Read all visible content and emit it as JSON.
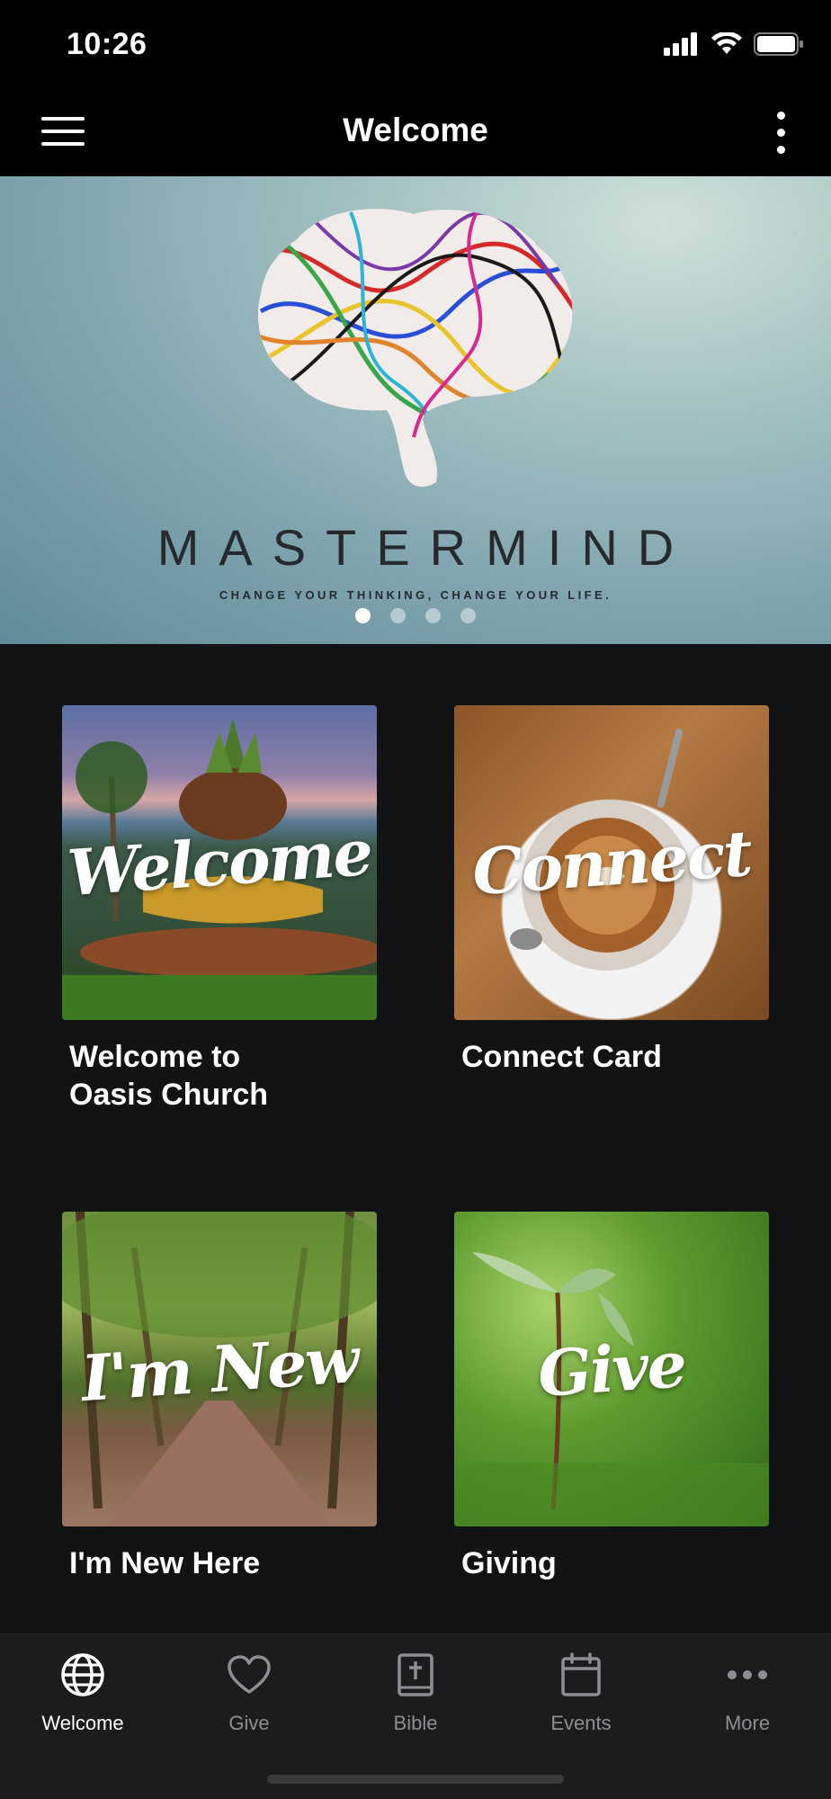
{
  "status_bar": {
    "time": "10:26"
  },
  "nav": {
    "title": "Welcome"
  },
  "hero": {
    "title": "MASTERMIND",
    "tagline": "CHANGE YOUR THINKING, CHANGE YOUR LIFE.",
    "slide_count": 4,
    "active_slide": 1
  },
  "cards": [
    {
      "script": "Welcome",
      "label": "Welcome to\nOasis Church"
    },
    {
      "script": "Connect",
      "label": "Connect Card"
    },
    {
      "script": "I'm New",
      "label": "I'm New Here"
    },
    {
      "script": "Give",
      "label": "Giving"
    }
  ],
  "tabs": [
    {
      "label": "Welcome",
      "icon": "globe-icon",
      "active": true
    },
    {
      "label": "Give",
      "icon": "heart-icon",
      "active": false
    },
    {
      "label": "Bible",
      "icon": "bible-icon",
      "active": false
    },
    {
      "label": "Events",
      "icon": "calendar-icon",
      "active": false
    },
    {
      "label": "More",
      "icon": "more-dots-icon",
      "active": false
    }
  ],
  "colors": {
    "background": "#121314",
    "bar": "#000000",
    "tab_bar": "#1c1c1e",
    "inactive_tab": "#8e8e93"
  }
}
